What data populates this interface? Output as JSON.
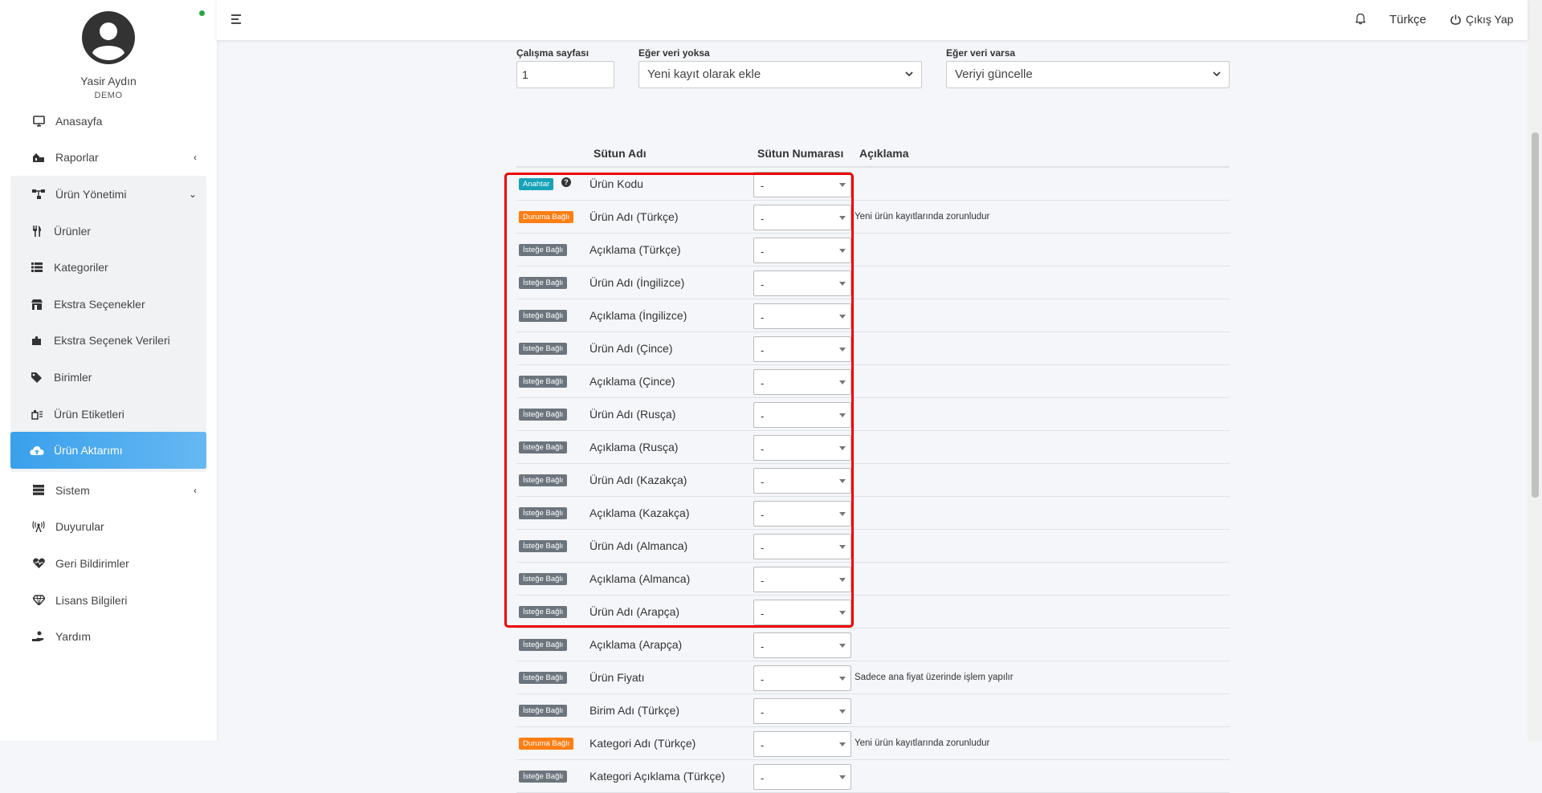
{
  "user": {
    "name": "Yasir Aydın",
    "role": "DEMO"
  },
  "sidebar": {
    "items": [
      {
        "label": "Anasayfa",
        "icon": "monitor-icon"
      },
      {
        "label": "Raporlar",
        "icon": "reports-icon"
      },
      {
        "label": "Ürün Yönetimi",
        "icon": "sitemap-icon"
      },
      {
        "label": "Sistem",
        "icon": "server-icon"
      },
      {
        "label": "Duyurular",
        "icon": "broadcast-icon"
      },
      {
        "label": "Geri Bildirimler",
        "icon": "heart-pulse-icon"
      },
      {
        "label": "Lisans Bilgileri",
        "icon": "gem-icon"
      },
      {
        "label": "Yardım",
        "icon": "hand-help-icon"
      }
    ],
    "subitems": [
      {
        "label": "Ürünler",
        "icon": "utensils-icon"
      },
      {
        "label": "Kategoriler",
        "icon": "list-icon"
      },
      {
        "label": "Ekstra Seçenekler",
        "icon": "shop-icon"
      },
      {
        "label": "Ekstra Seçenek Verileri",
        "icon": "puzzle-icon"
      },
      {
        "label": "Birimler",
        "icon": "tags-icon"
      },
      {
        "label": "Ürün Etiketleri",
        "icon": "label-icon"
      },
      {
        "label": "Ürün Aktarımı",
        "icon": "cloud-upload-icon"
      }
    ]
  },
  "topbar": {
    "language": "Türkçe",
    "logout": "Çıkış Yap"
  },
  "form": {
    "worksheet_label": "Çalışma sayfası",
    "worksheet_value": "1",
    "if_missing_label": "Eğer veri yoksa",
    "if_missing_value": "Yeni kayıt olarak ekle",
    "if_exists_label": "Eğer veri varsa",
    "if_exists_value": "Veriyi güncelle"
  },
  "table": {
    "headers": {
      "name": "Sütun Adı",
      "number": "Sütun Numarası",
      "desc": "Açıklama"
    },
    "rows": [
      {
        "badge": "Anahtar",
        "kind": "key",
        "name": "Ürün Kodu",
        "value": "-",
        "desc": ""
      },
      {
        "badge": "Duruma Bağlı",
        "kind": "cond",
        "name": "Ürün Adı (Türkçe)",
        "value": "-",
        "desc": "Yeni ürün kayıtlarında zorunludur"
      },
      {
        "badge": "İsteğe Bağlı",
        "kind": "opt",
        "name": "Açıklama (Türkçe)",
        "value": "-",
        "desc": ""
      },
      {
        "badge": "İsteğe Bağlı",
        "kind": "opt",
        "name": "Ürün Adı (İngilizce)",
        "value": "-",
        "desc": ""
      },
      {
        "badge": "İsteğe Bağlı",
        "kind": "opt",
        "name": "Açıklama (İngilizce)",
        "value": "-",
        "desc": ""
      },
      {
        "badge": "İsteğe Bağlı",
        "kind": "opt",
        "name": "Ürün Adı (Çince)",
        "value": "-",
        "desc": ""
      },
      {
        "badge": "İsteğe Bağlı",
        "kind": "opt",
        "name": "Açıklama (Çince)",
        "value": "-",
        "desc": ""
      },
      {
        "badge": "İsteğe Bağlı",
        "kind": "opt",
        "name": "Ürün Adı (Rusça)",
        "value": "-",
        "desc": ""
      },
      {
        "badge": "İsteğe Bağlı",
        "kind": "opt",
        "name": "Açıklama (Rusça)",
        "value": "-",
        "desc": ""
      },
      {
        "badge": "İsteğe Bağlı",
        "kind": "opt",
        "name": "Ürün Adı (Kazakça)",
        "value": "-",
        "desc": ""
      },
      {
        "badge": "İsteğe Bağlı",
        "kind": "opt",
        "name": "Açıklama (Kazakça)",
        "value": "-",
        "desc": ""
      },
      {
        "badge": "İsteğe Bağlı",
        "kind": "opt",
        "name": "Ürün Adı (Almanca)",
        "value": "-",
        "desc": ""
      },
      {
        "badge": "İsteğe Bağlı",
        "kind": "opt",
        "name": "Açıklama (Almanca)",
        "value": "-",
        "desc": ""
      },
      {
        "badge": "İsteğe Bağlı",
        "kind": "opt",
        "name": "Ürün Adı (Arapça)",
        "value": "-",
        "desc": ""
      },
      {
        "badge": "İsteğe Bağlı",
        "kind": "opt",
        "name": "Açıklama (Arapça)",
        "value": "-",
        "desc": ""
      },
      {
        "badge": "İsteğe Bağlı",
        "kind": "opt",
        "name": "Ürün Fiyatı",
        "value": "-",
        "desc": "Sadece ana fiyat üzerinde işlem yapılır"
      },
      {
        "badge": "İsteğe Bağlı",
        "kind": "opt",
        "name": "Birim Adı (Türkçe)",
        "value": "-",
        "desc": ""
      },
      {
        "badge": "Duruma Bağlı",
        "kind": "cond",
        "name": "Kategori Adı (Türkçe)",
        "value": "-",
        "desc": "Yeni ürün kayıtlarında zorunludur"
      },
      {
        "badge": "İsteğe Bağlı",
        "kind": "opt",
        "name": "Kategori Açıklama (Türkçe)",
        "value": "-",
        "desc": ""
      }
    ]
  }
}
